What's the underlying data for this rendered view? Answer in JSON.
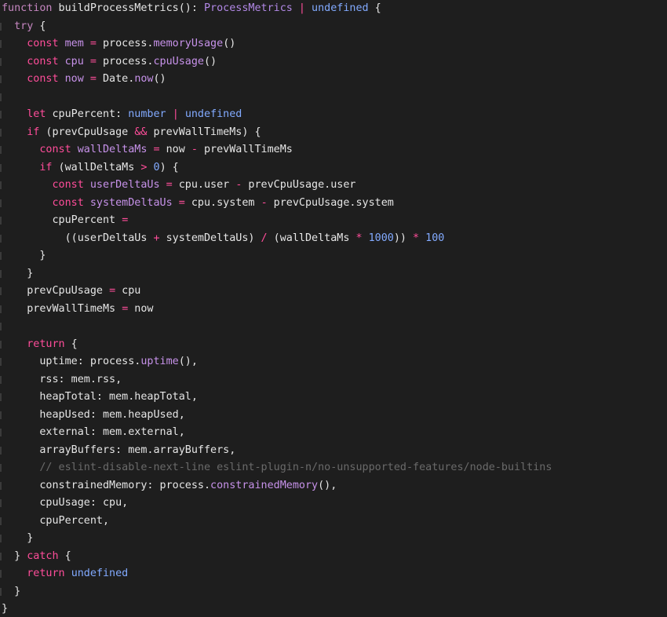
{
  "colors": {
    "background": "#1e1e1e",
    "keyword": "#c586c0",
    "declaration": "#ff4d9a",
    "variable": "#c792ea",
    "builtin": "#82aaff",
    "comment": "#6a6a6a",
    "plain": "#e6e6e6"
  },
  "code_lines": [
    [
      [
        "keyword",
        "function"
      ],
      [
        "plain",
        " buildProcessMetrics(): "
      ],
      [
        "type",
        "ProcessMetrics"
      ],
      [
        "plain",
        " "
      ],
      [
        "op",
        "|"
      ],
      [
        "plain",
        " "
      ],
      [
        "builtin",
        "undefined"
      ],
      [
        "plain",
        " {"
      ]
    ],
    [
      [
        "plain",
        "  "
      ],
      [
        "keyword",
        "try"
      ],
      [
        "plain",
        " {"
      ]
    ],
    [
      [
        "plain",
        "    "
      ],
      [
        "decl",
        "const"
      ],
      [
        "plain",
        " "
      ],
      [
        "var",
        "mem"
      ],
      [
        "plain",
        " "
      ],
      [
        "op",
        "="
      ],
      [
        "plain",
        " process."
      ],
      [
        "fn",
        "memoryUsage"
      ],
      [
        "plain",
        "()"
      ]
    ],
    [
      [
        "plain",
        "    "
      ],
      [
        "decl",
        "const"
      ],
      [
        "plain",
        " "
      ],
      [
        "var",
        "cpu"
      ],
      [
        "plain",
        " "
      ],
      [
        "op",
        "="
      ],
      [
        "plain",
        " process."
      ],
      [
        "fn",
        "cpuUsage"
      ],
      [
        "plain",
        "()"
      ]
    ],
    [
      [
        "plain",
        "    "
      ],
      [
        "decl",
        "const"
      ],
      [
        "plain",
        " "
      ],
      [
        "var",
        "now"
      ],
      [
        "plain",
        " "
      ],
      [
        "op",
        "="
      ],
      [
        "plain",
        " Date."
      ],
      [
        "fn",
        "now"
      ],
      [
        "plain",
        "()"
      ]
    ],
    [
      [
        "plain",
        ""
      ]
    ],
    [
      [
        "plain",
        "    "
      ],
      [
        "decl",
        "let"
      ],
      [
        "plain",
        " cpuPercent: "
      ],
      [
        "builtin",
        "number"
      ],
      [
        "plain",
        " "
      ],
      [
        "op",
        "|"
      ],
      [
        "plain",
        " "
      ],
      [
        "builtin",
        "undefined"
      ]
    ],
    [
      [
        "plain",
        "    "
      ],
      [
        "decl",
        "if"
      ],
      [
        "plain",
        " (prevCpuUsage "
      ],
      [
        "op",
        "&&"
      ],
      [
        "plain",
        " prevWallTimeMs) {"
      ]
    ],
    [
      [
        "plain",
        "      "
      ],
      [
        "decl",
        "const"
      ],
      [
        "plain",
        " "
      ],
      [
        "var",
        "wallDeltaMs"
      ],
      [
        "plain",
        " "
      ],
      [
        "op",
        "="
      ],
      [
        "plain",
        " now "
      ],
      [
        "op",
        "-"
      ],
      [
        "plain",
        " prevWallTimeMs"
      ]
    ],
    [
      [
        "plain",
        "      "
      ],
      [
        "decl",
        "if"
      ],
      [
        "plain",
        " (wallDeltaMs "
      ],
      [
        "op",
        ">"
      ],
      [
        "plain",
        " "
      ],
      [
        "num",
        "0"
      ],
      [
        "plain",
        ") {"
      ]
    ],
    [
      [
        "plain",
        "        "
      ],
      [
        "decl",
        "const"
      ],
      [
        "plain",
        " "
      ],
      [
        "var",
        "userDeltaUs"
      ],
      [
        "plain",
        " "
      ],
      [
        "op",
        "="
      ],
      [
        "plain",
        " cpu.user "
      ],
      [
        "op",
        "-"
      ],
      [
        "plain",
        " prevCpuUsage.user"
      ]
    ],
    [
      [
        "plain",
        "        "
      ],
      [
        "decl",
        "const"
      ],
      [
        "plain",
        " "
      ],
      [
        "var",
        "systemDeltaUs"
      ],
      [
        "plain",
        " "
      ],
      [
        "op",
        "="
      ],
      [
        "plain",
        " cpu.system "
      ],
      [
        "op",
        "-"
      ],
      [
        "plain",
        " prevCpuUsage.system"
      ]
    ],
    [
      [
        "plain",
        "        cpuPercent "
      ],
      [
        "op",
        "="
      ]
    ],
    [
      [
        "plain",
        "          ((userDeltaUs "
      ],
      [
        "op",
        "+"
      ],
      [
        "plain",
        " systemDeltaUs) "
      ],
      [
        "op",
        "/"
      ],
      [
        "plain",
        " (wallDeltaMs "
      ],
      [
        "op",
        "*"
      ],
      [
        "plain",
        " "
      ],
      [
        "num",
        "1000"
      ],
      [
        "plain",
        ")) "
      ],
      [
        "op",
        "*"
      ],
      [
        "plain",
        " "
      ],
      [
        "num",
        "100"
      ]
    ],
    [
      [
        "plain",
        "      }"
      ]
    ],
    [
      [
        "plain",
        "    }"
      ]
    ],
    [
      [
        "plain",
        "    prevCpuUsage "
      ],
      [
        "op",
        "="
      ],
      [
        "plain",
        " cpu"
      ]
    ],
    [
      [
        "plain",
        "    prevWallTimeMs "
      ],
      [
        "op",
        "="
      ],
      [
        "plain",
        " now"
      ]
    ],
    [
      [
        "plain",
        ""
      ]
    ],
    [
      [
        "plain",
        "    "
      ],
      [
        "decl",
        "return"
      ],
      [
        "plain",
        " {"
      ]
    ],
    [
      [
        "plain",
        "      uptime: process."
      ],
      [
        "fn",
        "uptime"
      ],
      [
        "plain",
        "(),"
      ]
    ],
    [
      [
        "plain",
        "      rss: mem.rss,"
      ]
    ],
    [
      [
        "plain",
        "      heapTotal: mem.heapTotal,"
      ]
    ],
    [
      [
        "plain",
        "      heapUsed: mem.heapUsed,"
      ]
    ],
    [
      [
        "plain",
        "      external: mem.external,"
      ]
    ],
    [
      [
        "plain",
        "      arrayBuffers: mem.arrayBuffers,"
      ]
    ],
    [
      [
        "plain",
        "      "
      ],
      [
        "comment",
        "// eslint-disable-next-line eslint-plugin-n/no-unsupported-features/node-builtins"
      ]
    ],
    [
      [
        "plain",
        "      constrainedMemory: process."
      ],
      [
        "fn",
        "constrainedMemory"
      ],
      [
        "plain",
        "(),"
      ]
    ],
    [
      [
        "plain",
        "      cpuUsage: cpu,"
      ]
    ],
    [
      [
        "plain",
        "      cpuPercent,"
      ]
    ],
    [
      [
        "plain",
        "    }"
      ]
    ],
    [
      [
        "plain",
        "  } "
      ],
      [
        "decl",
        "catch"
      ],
      [
        "plain",
        " {"
      ]
    ],
    [
      [
        "plain",
        "    "
      ],
      [
        "decl",
        "return"
      ],
      [
        "plain",
        " "
      ],
      [
        "builtin",
        "undefined"
      ]
    ],
    [
      [
        "plain",
        "  }"
      ]
    ],
    [
      [
        "plain",
        "}"
      ]
    ]
  ]
}
